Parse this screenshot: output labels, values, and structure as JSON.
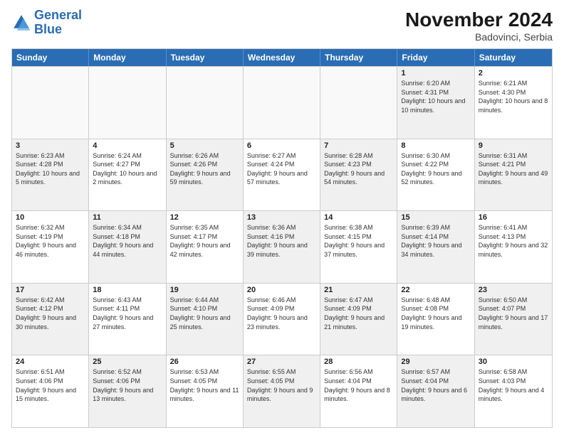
{
  "header": {
    "logo_line1": "General",
    "logo_line2": "Blue",
    "month_title": "November 2024",
    "location": "Badovinci, Serbia"
  },
  "weekdays": [
    "Sunday",
    "Monday",
    "Tuesday",
    "Wednesday",
    "Thursday",
    "Friday",
    "Saturday"
  ],
  "rows": [
    [
      {
        "day": "",
        "info": "",
        "shaded": false,
        "empty": true
      },
      {
        "day": "",
        "info": "",
        "shaded": false,
        "empty": true
      },
      {
        "day": "",
        "info": "",
        "shaded": false,
        "empty": true
      },
      {
        "day": "",
        "info": "",
        "shaded": false,
        "empty": true
      },
      {
        "day": "",
        "info": "",
        "shaded": false,
        "empty": true
      },
      {
        "day": "1",
        "info": "Sunrise: 6:20 AM\nSunset: 4:31 PM\nDaylight: 10 hours\nand 10 minutes.",
        "shaded": true,
        "empty": false
      },
      {
        "day": "2",
        "info": "Sunrise: 6:21 AM\nSunset: 4:30 PM\nDaylight: 10 hours\nand 8 minutes.",
        "shaded": false,
        "empty": false
      }
    ],
    [
      {
        "day": "3",
        "info": "Sunrise: 6:23 AM\nSunset: 4:28 PM\nDaylight: 10 hours\nand 5 minutes.",
        "shaded": true,
        "empty": false
      },
      {
        "day": "4",
        "info": "Sunrise: 6:24 AM\nSunset: 4:27 PM\nDaylight: 10 hours\nand 2 minutes.",
        "shaded": false,
        "empty": false
      },
      {
        "day": "5",
        "info": "Sunrise: 6:26 AM\nSunset: 4:26 PM\nDaylight: 9 hours\nand 59 minutes.",
        "shaded": true,
        "empty": false
      },
      {
        "day": "6",
        "info": "Sunrise: 6:27 AM\nSunset: 4:24 PM\nDaylight: 9 hours\nand 57 minutes.",
        "shaded": false,
        "empty": false
      },
      {
        "day": "7",
        "info": "Sunrise: 6:28 AM\nSunset: 4:23 PM\nDaylight: 9 hours\nand 54 minutes.",
        "shaded": true,
        "empty": false
      },
      {
        "day": "8",
        "info": "Sunrise: 6:30 AM\nSunset: 4:22 PM\nDaylight: 9 hours\nand 52 minutes.",
        "shaded": false,
        "empty": false
      },
      {
        "day": "9",
        "info": "Sunrise: 6:31 AM\nSunset: 4:21 PM\nDaylight: 9 hours\nand 49 minutes.",
        "shaded": true,
        "empty": false
      }
    ],
    [
      {
        "day": "10",
        "info": "Sunrise: 6:32 AM\nSunset: 4:19 PM\nDaylight: 9 hours\nand 46 minutes.",
        "shaded": false,
        "empty": false
      },
      {
        "day": "11",
        "info": "Sunrise: 6:34 AM\nSunset: 4:18 PM\nDaylight: 9 hours\nand 44 minutes.",
        "shaded": true,
        "empty": false
      },
      {
        "day": "12",
        "info": "Sunrise: 6:35 AM\nSunset: 4:17 PM\nDaylight: 9 hours\nand 42 minutes.",
        "shaded": false,
        "empty": false
      },
      {
        "day": "13",
        "info": "Sunrise: 6:36 AM\nSunset: 4:16 PM\nDaylight: 9 hours\nand 39 minutes.",
        "shaded": true,
        "empty": false
      },
      {
        "day": "14",
        "info": "Sunrise: 6:38 AM\nSunset: 4:15 PM\nDaylight: 9 hours\nand 37 minutes.",
        "shaded": false,
        "empty": false
      },
      {
        "day": "15",
        "info": "Sunrise: 6:39 AM\nSunset: 4:14 PM\nDaylight: 9 hours\nand 34 minutes.",
        "shaded": true,
        "empty": false
      },
      {
        "day": "16",
        "info": "Sunrise: 6:41 AM\nSunset: 4:13 PM\nDaylight: 9 hours\nand 32 minutes.",
        "shaded": false,
        "empty": false
      }
    ],
    [
      {
        "day": "17",
        "info": "Sunrise: 6:42 AM\nSunset: 4:12 PM\nDaylight: 9 hours\nand 30 minutes.",
        "shaded": true,
        "empty": false
      },
      {
        "day": "18",
        "info": "Sunrise: 6:43 AM\nSunset: 4:11 PM\nDaylight: 9 hours\nand 27 minutes.",
        "shaded": false,
        "empty": false
      },
      {
        "day": "19",
        "info": "Sunrise: 6:44 AM\nSunset: 4:10 PM\nDaylight: 9 hours\nand 25 minutes.",
        "shaded": true,
        "empty": false
      },
      {
        "day": "20",
        "info": "Sunrise: 6:46 AM\nSunset: 4:09 PM\nDaylight: 9 hours\nand 23 minutes.",
        "shaded": false,
        "empty": false
      },
      {
        "day": "21",
        "info": "Sunrise: 6:47 AM\nSunset: 4:09 PM\nDaylight: 9 hours\nand 21 minutes.",
        "shaded": true,
        "empty": false
      },
      {
        "day": "22",
        "info": "Sunrise: 6:48 AM\nSunset: 4:08 PM\nDaylight: 9 hours\nand 19 minutes.",
        "shaded": false,
        "empty": false
      },
      {
        "day": "23",
        "info": "Sunrise: 6:50 AM\nSunset: 4:07 PM\nDaylight: 9 hours\nand 17 minutes.",
        "shaded": true,
        "empty": false
      }
    ],
    [
      {
        "day": "24",
        "info": "Sunrise: 6:51 AM\nSunset: 4:06 PM\nDaylight: 9 hours\nand 15 minutes.",
        "shaded": false,
        "empty": false
      },
      {
        "day": "25",
        "info": "Sunrise: 6:52 AM\nSunset: 4:06 PM\nDaylight: 9 hours\nand 13 minutes.",
        "shaded": true,
        "empty": false
      },
      {
        "day": "26",
        "info": "Sunrise: 6:53 AM\nSunset: 4:05 PM\nDaylight: 9 hours\nand 11 minutes.",
        "shaded": false,
        "empty": false
      },
      {
        "day": "27",
        "info": "Sunrise: 6:55 AM\nSunset: 4:05 PM\nDaylight: 9 hours\nand 9 minutes.",
        "shaded": true,
        "empty": false
      },
      {
        "day": "28",
        "info": "Sunrise: 6:56 AM\nSunset: 4:04 PM\nDaylight: 9 hours\nand 8 minutes.",
        "shaded": false,
        "empty": false
      },
      {
        "day": "29",
        "info": "Sunrise: 6:57 AM\nSunset: 4:04 PM\nDaylight: 9 hours\nand 6 minutes.",
        "shaded": true,
        "empty": false
      },
      {
        "day": "30",
        "info": "Sunrise: 6:58 AM\nSunset: 4:03 PM\nDaylight: 9 hours\nand 4 minutes.",
        "shaded": false,
        "empty": false
      }
    ]
  ]
}
